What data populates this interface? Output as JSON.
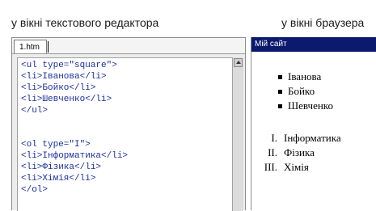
{
  "captions": {
    "editor": "у вікні текстового редактора",
    "browser": "у вікні браузера"
  },
  "editor": {
    "tab_label": "1.htm",
    "code_lines": [
      "<ul type=\"square\">",
      "<li>Іванова</li>",
      "<li>Бойко</li>",
      "<li>Шевченко</li>",
      "</ul>",
      "",
      "<ol type=\"I\">",
      "<li>Інформатика</li>",
      "<li>Фізика</li>",
      "<li>Хімія</li>",
      "</ol>"
    ]
  },
  "browser": {
    "window_title": "Мій сайт",
    "unordered_list": [
      "Іванова",
      "Бойко",
      "Шевченко"
    ],
    "ordered_markers": [
      "I.",
      "II.",
      "III."
    ],
    "ordered_list": [
      "Інформатика",
      "Фізика",
      "Хімія"
    ]
  }
}
